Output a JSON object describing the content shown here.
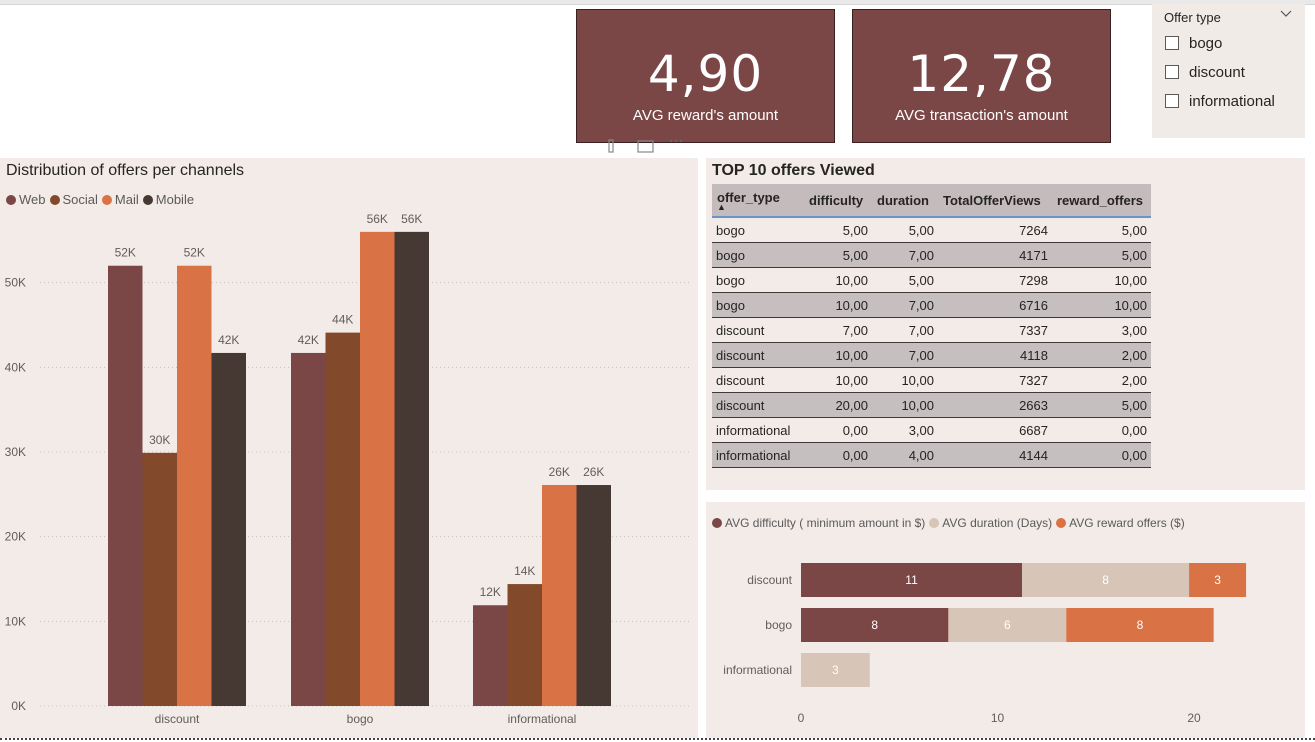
{
  "cards": [
    {
      "value": "4,90",
      "label": "AVG reward's amount"
    },
    {
      "value": "12,78",
      "label": "AVG transaction's amount"
    }
  ],
  "slicer": {
    "title": "Offer type",
    "options": [
      "bogo",
      "discount",
      "informational"
    ]
  },
  "chart_data": [
    {
      "type": "bar",
      "title": "Distribution of offers per channels",
      "categories": [
        "discount",
        "bogo",
        "informational"
      ],
      "series": [
        {
          "name": "Web",
          "values": [
            52000,
            41700,
            11900
          ],
          "labels": [
            "52K",
            "42K",
            "12K"
          ]
        },
        {
          "name": "Social",
          "values": [
            29900,
            44100,
            14400
          ],
          "labels": [
            "30K",
            "44K",
            "14K"
          ]
        },
        {
          "name": "Mail",
          "values": [
            52000,
            56000,
            26100
          ],
          "labels": [
            "52K",
            "56K",
            "26K"
          ]
        },
        {
          "name": "Mobile",
          "values": [
            41700,
            56000,
            26100
          ],
          "labels": [
            "42K",
            "56K",
            "26K"
          ]
        }
      ],
      "yticks": [
        "0K",
        "10K",
        "20K",
        "30K",
        "40K",
        "50K"
      ],
      "ylim": [
        0,
        60000
      ],
      "grid": true,
      "legend": "top-left",
      "colors": [
        "#7b4646",
        "#82492a",
        "#d97244",
        "#463833"
      ]
    },
    {
      "type": "bar",
      "orientation": "horizontal",
      "stacked": true,
      "categories": [
        "discount",
        "bogo",
        "informational"
      ],
      "series": [
        {
          "name": "AVG difficulty ( minimum amount in $)",
          "values": [
            11.25,
            7.5,
            0
          ],
          "labels": [
            "11",
            "8",
            ""
          ]
        },
        {
          "name": "AVG duration (Days)",
          "values": [
            8.5,
            6,
            3.5
          ],
          "labels": [
            "8",
            "6",
            "3"
          ]
        },
        {
          "name": "AVG reward offers ($)",
          "values": [
            2.9,
            7.5,
            0
          ],
          "labels": [
            "3",
            "8",
            ""
          ]
        }
      ],
      "xticks": [
        "0",
        "10",
        "20"
      ],
      "xlim": [
        0,
        25
      ],
      "legend": "top-left",
      "colors": [
        "#7b4646",
        "#d7c5b8",
        "#d97244"
      ]
    }
  ],
  "table": {
    "title": "TOP 10 offers Viewed",
    "columns": [
      "offer_type",
      "difficulty",
      "duration",
      "TotalOfferViews",
      "reward_offers"
    ],
    "sort_indicator": "▲",
    "rows": [
      [
        "bogo",
        "5,00",
        "5,00",
        "7264",
        "5,00"
      ],
      [
        "bogo",
        "5,00",
        "7,00",
        "4171",
        "5,00"
      ],
      [
        "bogo",
        "10,00",
        "5,00",
        "7298",
        "10,00"
      ],
      [
        "bogo",
        "10,00",
        "7,00",
        "6716",
        "10,00"
      ],
      [
        "discount",
        "7,00",
        "7,00",
        "7337",
        "3,00"
      ],
      [
        "discount",
        "10,00",
        "7,00",
        "4118",
        "2,00"
      ],
      [
        "discount",
        "10,00",
        "10,00",
        "7327",
        "2,00"
      ],
      [
        "discount",
        "20,00",
        "10,00",
        "2663",
        "5,00"
      ],
      [
        "informational",
        "0,00",
        "3,00",
        "6687",
        "0,00"
      ],
      [
        "informational",
        "0,00",
        "4,00",
        "4144",
        "0,00"
      ]
    ]
  }
}
